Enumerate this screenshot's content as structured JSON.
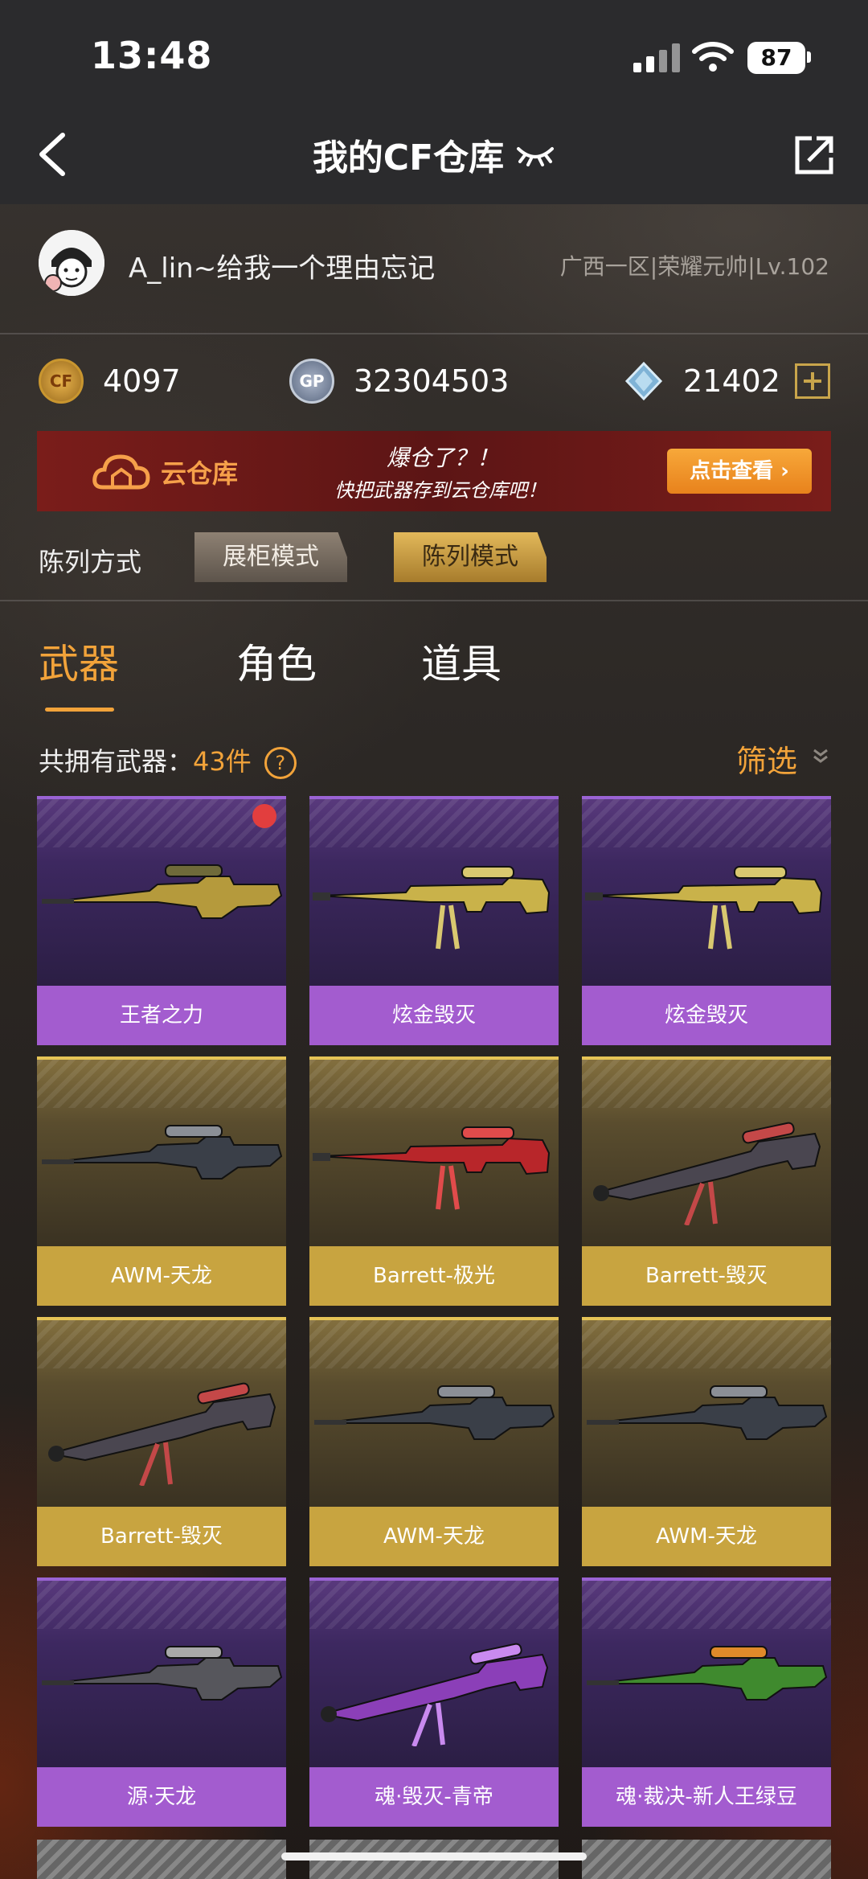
{
  "status_bar": {
    "time": "13:48",
    "battery": "87"
  },
  "nav": {
    "title": "我的CF仓库"
  },
  "profile": {
    "username": "A_lin~给我一个理由忘记",
    "server": "广西一区|荣耀元帅|Lv.102"
  },
  "currency": [
    {
      "icon": "cf-coin-icon",
      "value": "4097"
    },
    {
      "icon": "gp-coin-icon",
      "label": "GP",
      "value": "32304503"
    },
    {
      "icon": "diamond-icon",
      "value": "21402"
    }
  ],
  "banner": {
    "title": "云仓库",
    "line1": "爆仓了？！",
    "line2": "快把武器存到云仓库吧！",
    "button": "点击查看"
  },
  "display_mode": {
    "label": "陈列方式",
    "option_a": "展柜模式",
    "option_b": "陈列模式"
  },
  "tabs": [
    "武器",
    "角色",
    "道具"
  ],
  "inventory": {
    "count_prefix": "共拥有武器：",
    "count": "43件",
    "help": "?",
    "filter": "筛选"
  },
  "weapons": [
    {
      "name": "王者之力",
      "rarity": "purple",
      "new": true
    },
    {
      "name": "炫金毁灭",
      "rarity": "purple"
    },
    {
      "name": "炫金毁灭",
      "rarity": "purple"
    },
    {
      "name": "AWM-天龙",
      "rarity": "gold"
    },
    {
      "name": "Barrett-极光",
      "rarity": "gold"
    },
    {
      "name": "Barrett-毁灭",
      "rarity": "gold"
    },
    {
      "name": "Barrett-毁灭",
      "rarity": "gold"
    },
    {
      "name": "AWM-天龙",
      "rarity": "gold"
    },
    {
      "name": "AWM-天龙",
      "rarity": "gold"
    },
    {
      "name": "源·天龙",
      "rarity": "purple"
    },
    {
      "name": "魂·毁灭-青帝",
      "rarity": "purple"
    },
    {
      "name": "魂·裁决-新人王绿豆",
      "rarity": "purple"
    }
  ],
  "colors": {
    "accent": "#f2a33a",
    "purple": "#a35ccf",
    "gold": "#c8a440"
  }
}
